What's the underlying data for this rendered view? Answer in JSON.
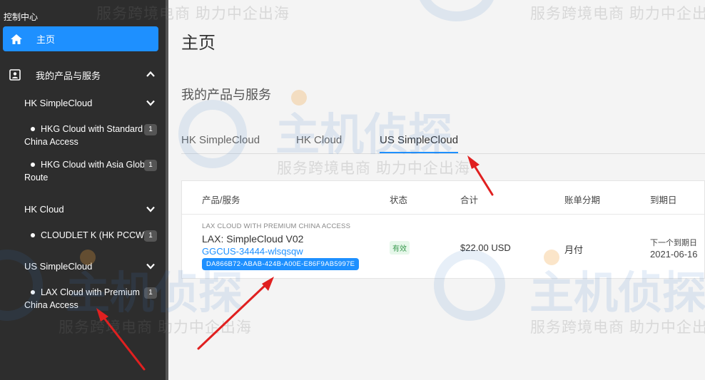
{
  "sidebar": {
    "title": "控制中心",
    "home_label": "主页",
    "section_label": "我的产品与服务",
    "groups": [
      {
        "label": "HK SimpleCloud",
        "items": [
          {
            "label": "HKG Cloud with Standard China Access",
            "count": "1"
          },
          {
            "label": "HKG Cloud with Asia Global Route",
            "count": "1"
          }
        ]
      },
      {
        "label": "HK Cloud",
        "items": [
          {
            "label": "CLOUDLET K (HK PCCW)",
            "count": "1"
          }
        ]
      },
      {
        "label": "US SimpleCloud",
        "items": [
          {
            "label": "LAX Cloud with Premium China Access",
            "count": "1"
          }
        ]
      }
    ]
  },
  "main": {
    "page_title": "主页",
    "section_title": "我的产品与服务",
    "tabs": [
      {
        "label": "HK SimpleCloud",
        "active": false
      },
      {
        "label": "HK Cloud",
        "active": false
      },
      {
        "label": "US SimpleCloud",
        "active": true
      }
    ],
    "table": {
      "headers": [
        "产品/服务",
        "状态",
        "合计",
        "账单分期",
        "到期日"
      ],
      "row": {
        "category": "LAX CLOUD WITH PREMIUM CHINA ACCESS",
        "name": "LAX: SimpleCloud V02",
        "domain": "GGCUS-34444-wlsqsqw",
        "uuid": "DA866B72-ABAB-424B-A00E-E86F9AB5997E",
        "status": "有效",
        "total": "$22.00 USD",
        "billing_cycle": "月付",
        "due_label": "下一个到期日",
        "due_date": "2021-06-16"
      }
    }
  },
  "watermark": {
    "small_text": "服务跨境电商 助力中企出海",
    "brand_text": "主机侦探"
  },
  "colors": {
    "accent": "#1e90ff",
    "sidebar_bg": "#2d2d2d",
    "annotation_arrow": "#e02020",
    "status_green": "#3a9a4f"
  }
}
